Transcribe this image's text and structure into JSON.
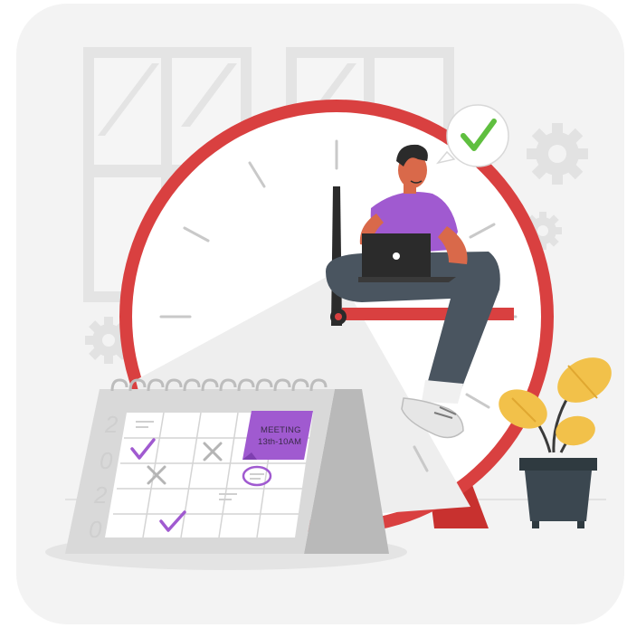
{
  "calendar": {
    "note_line1": "MEETING",
    "note_line2": "13th-10AM",
    "year_digits": [
      "2",
      "0",
      "2",
      "0"
    ]
  },
  "colors": {
    "clock_red": "#d94040",
    "purple": "#a05ad0",
    "check_green": "#5fbf3f",
    "plant_yellow": "#f2c14a",
    "pants_gray": "#4a5560"
  },
  "icons": [
    "gear-icon",
    "check-icon",
    "laptop-icon",
    "window-icon",
    "plant-icon",
    "calendar-icon",
    "clock-icon"
  ]
}
